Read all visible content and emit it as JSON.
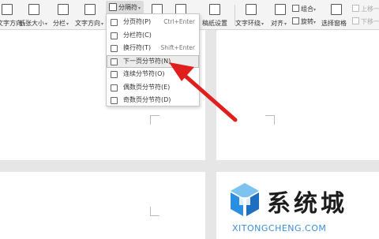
{
  "ribbon": {
    "items": [
      {
        "label": "文字方向",
        "caret": "▾"
      },
      {
        "label": "纸张大小",
        "caret": "▾"
      },
      {
        "label": "分栏",
        "caret": "▾"
      },
      {
        "label": "文字方向",
        "caret": "▾"
      },
      {
        "label": "分隔符",
        "caret": "▾"
      },
      {
        "label": "稿纸设置",
        "caret": ""
      },
      {
        "label": "文字环绕",
        "caret": "▾"
      },
      {
        "label": "对齐",
        "caret": "▾"
      },
      {
        "label": "组合",
        "caret": "▾"
      },
      {
        "label": "旋转",
        "caret": "▾"
      },
      {
        "label": "选择窗格",
        "caret": ""
      },
      {
        "label": "上移一层",
        "caret": ""
      },
      {
        "label": "下移一层",
        "caret": ""
      }
    ]
  },
  "menu": {
    "items": [
      {
        "label": "分页符(P)",
        "shortcut": "Ctrl+Enter"
      },
      {
        "label": "分栏符(C)",
        "shortcut": ""
      },
      {
        "label": "换行符(T)",
        "shortcut": "Shift+Enter"
      },
      {
        "label": "下一页分节符(N)",
        "shortcut": ""
      },
      {
        "label": "连续分节符(O)",
        "shortcut": ""
      },
      {
        "label": "偶数页分节符(E)",
        "shortcut": ""
      },
      {
        "label": "奇数页分节符(D)",
        "shortcut": ""
      }
    ],
    "highlighted_index": 3
  },
  "watermark": {
    "cn": "系统城",
    "en": "XITONGCHENG.COM"
  },
  "colors": {
    "arrow": "#e01e1e",
    "logo_blue": "#2a8fe0",
    "logo_light": "#7cc4ef"
  }
}
